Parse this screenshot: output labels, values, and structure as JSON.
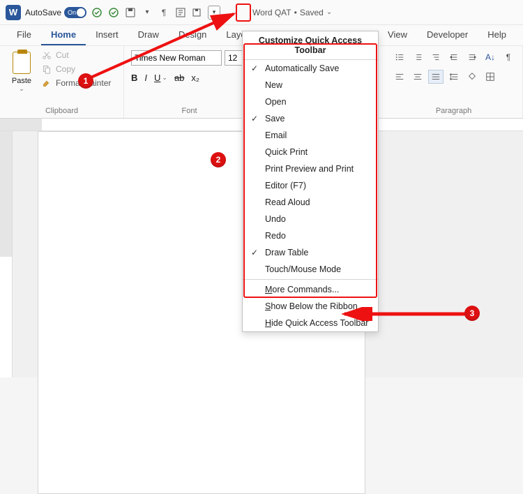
{
  "titlebar": {
    "app_letter": "W",
    "autosave_label": "AutoSave",
    "autosave_toggle": "On",
    "doc_name": "Word QAT",
    "saved_status": "Saved"
  },
  "qat_icons": [
    "save-check-icon",
    "save-check-icon",
    "save-icon",
    "pilcrow-icon",
    "text-icon",
    "save-as-icon"
  ],
  "tabs": [
    "File",
    "Home",
    "Insert",
    "Draw",
    "Design",
    "Layout",
    "View",
    "Developer",
    "Help"
  ],
  "active_tab_index": 1,
  "clipboard": {
    "paste_label": "Paste",
    "cut_label": "Cut",
    "copy_label": "Copy",
    "format_painter_label": "Format Painter",
    "group_label": "Clipboard"
  },
  "font": {
    "name": "Times New Roman",
    "size": "12",
    "group_label": "Font",
    "b": "B",
    "i": "I",
    "u": "U",
    "strike": "ab",
    "sub": "x₂"
  },
  "paragraph": {
    "group_label": "Paragraph"
  },
  "dropdown": {
    "title": "Customize Quick Access Toolbar",
    "items": [
      {
        "label": "Automatically Save",
        "checked": true
      },
      {
        "label": "New",
        "checked": false
      },
      {
        "label": "Open",
        "checked": false
      },
      {
        "label": "Save",
        "checked": true
      },
      {
        "label": "Email",
        "checked": false
      },
      {
        "label": "Quick Print",
        "checked": false
      },
      {
        "label": "Print Preview and Print",
        "checked": false
      },
      {
        "label": "Editor (F7)",
        "checked": false
      },
      {
        "label": "Read Aloud",
        "checked": false
      },
      {
        "label": "Undo",
        "checked": false
      },
      {
        "label": "Redo",
        "checked": false
      },
      {
        "label": "Draw Table",
        "checked": true
      },
      {
        "label": "Touch/Mouse Mode",
        "checked": false
      }
    ],
    "more_commands": "More Commands...",
    "show_below": "Show Below the Ribbon",
    "hide_qat": "Hide Quick Access Toolbar"
  },
  "callouts": {
    "one": "1",
    "two": "2",
    "three": "3"
  }
}
